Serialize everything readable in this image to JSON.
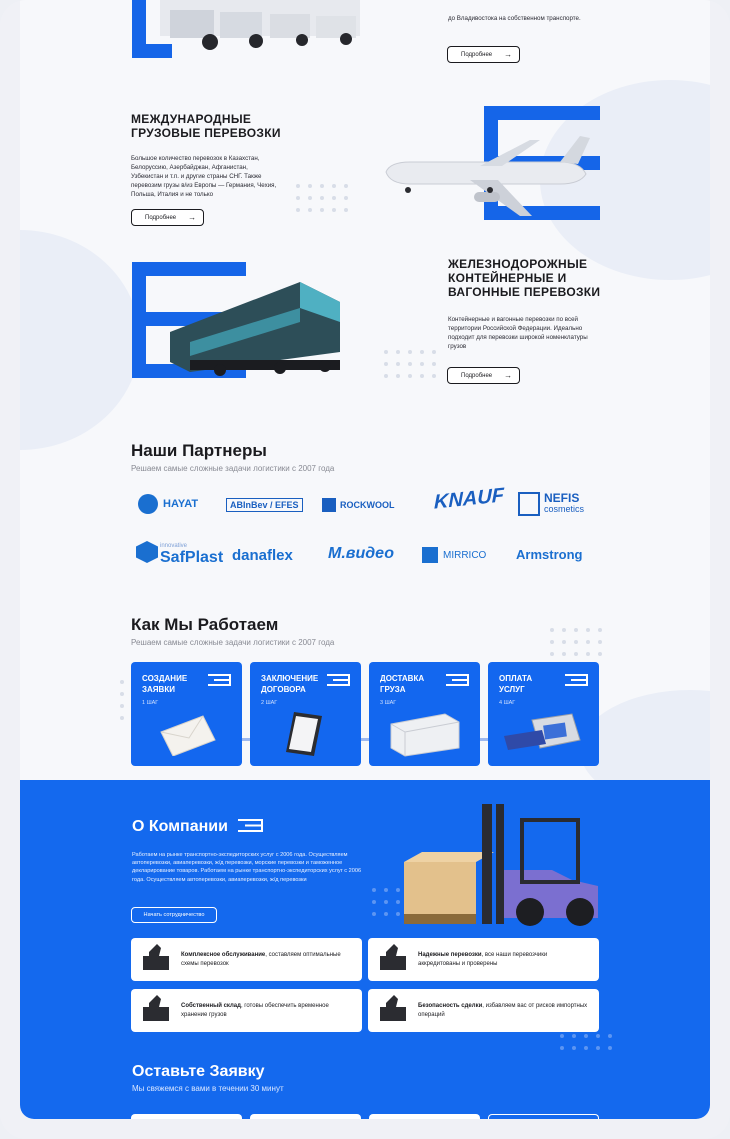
{
  "services": [
    {
      "title_line1": "",
      "title_line2": "",
      "title_line3": "",
      "text": "до Владивостока на собственном транспорте.",
      "button_label": "Подробнее"
    },
    {
      "title_line1": "МЕЖДУНАРОДНЫЕ",
      "title_line2": "ГРУЗОВЫЕ ПЕРЕВОЗКИ",
      "title_line3": "",
      "text": "Большое количество перевозок в Казахстан, Белоруссию, Азербайджан, Афганистан, Узбекистан и т.п. и другие страны СНГ. Также перевозим грузы в/из Европы — Германия, Чехия, Польша, Италия и не только",
      "button_label": "Подробнее"
    },
    {
      "title_line1": "ЖЕЛЕЗНОДОРОЖНЫЕ",
      "title_line2": "КОНТЕЙНЕРНЫЕ И",
      "title_line3": "ВАГОННЫЕ ПЕРЕВОЗКИ",
      "text": "Контейнерные и вагонные перевозки по всей территории Российской Федерации. Идеально подходит для перевозки широкой номенклатуры грузов",
      "button_label": "Подробнее"
    }
  ],
  "partners": {
    "title": "Наши Партнеры",
    "subtitle": "Решаем самые сложные задачи логистики с 2007 года",
    "logos": [
      "HAYAT",
      "ABInBev / EFES",
      "ROCKWOOL",
      "KNAUF",
      "NEFIS",
      "cosmetics",
      "innovative",
      "SafPlast",
      "danaflex",
      "М.видео",
      "MIRRICO",
      "Armstrong"
    ]
  },
  "how": {
    "title": "Как Мы Работаем",
    "subtitle": "Решаем самые сложные задачи логистики с 2007 года",
    "steps": [
      {
        "line1": "СОЗДАНИЕ",
        "line2": "ЗАЯВКИ",
        "num": "1 ШАГ"
      },
      {
        "line1": "ЗАКЛЮЧЕНИЕ",
        "line2": "ДОГОВОРА",
        "num": "2 ШАГ"
      },
      {
        "line1": "ДОСТАВКА",
        "line2": "ГРУЗА",
        "num": "3 ШАГ"
      },
      {
        "line1": "ОПЛАТА",
        "line2": "УСЛУГ",
        "num": "4 ШАГ"
      }
    ]
  },
  "about": {
    "title": "О Компании",
    "text": "Работаем на рынке транспортно-экспедиторских услуг с 2006 года. Осуществляем автоперевозки, авиаперевозки, ж/д перевозки, морские перевозки и таможенное декларирование товаров. Работаем на рынке транспортно-экспедиторских услуг с 2006 года. Осуществляем автоперевозки, авиаперевозки, ж/д перевозки",
    "button_label": "Начать сотрудничество",
    "features": [
      {
        "bold": "Комплексное обслуживание",
        "rest": ", составляем оптимальные схемы перевозок"
      },
      {
        "bold": "Надежные перевозки",
        "rest": ", все наши перевозчики аккредитованы и проверены"
      },
      {
        "bold": "Собственный склад",
        "rest": ", готовы обеспечить временное хранение грузов"
      },
      {
        "bold": "Безопасность сделки",
        "rest": ", избавляем вас от рисков импортных операций"
      }
    ]
  },
  "request": {
    "title": "Оставьте Заявку",
    "subtitle": "Мы свяжемся с вами в течении 30 минут"
  },
  "colors": {
    "accent": "#1469ee",
    "dark": "#1b1b1f",
    "card": "#1367ef"
  },
  "icons": [
    "arrow-right-icon",
    "brand-mark-icon",
    "thumbs-up-icon"
  ]
}
